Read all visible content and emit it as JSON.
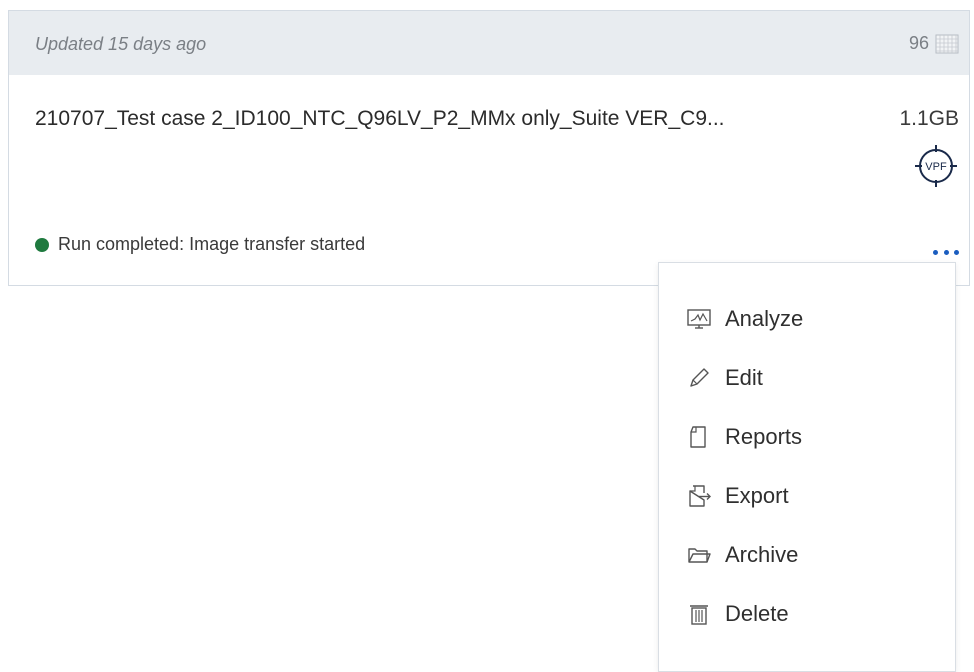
{
  "card": {
    "updated": "Updated 15 days ago",
    "well_count": "96",
    "run_name": "210707_Test case 2_ID100_NTC_Q96LV_P2_MMx only_Suite VER_C9...",
    "size": "1.1GB",
    "vpf_badge": "VPF",
    "status_text": "Run completed: Image transfer started",
    "status_color": "#1f7a3f"
  },
  "menu": {
    "analyze": "Analyze",
    "edit": "Edit",
    "reports": "Reports",
    "export": "Export",
    "archive": "Archive",
    "delete": "Delete"
  },
  "icons": {
    "plate": "plate-grid-icon",
    "vpf": "vpf-crosshair-icon",
    "more": "more-dots-icon",
    "analyze": "monitor-chart-icon",
    "edit": "pencil-icon",
    "reports": "document-icon",
    "export": "export-icon",
    "archive": "folder-icon",
    "delete": "trash-icon"
  },
  "colors": {
    "header_bg": "#e8ecf0",
    "accent": "#1b5dbf",
    "border": "#d4dbe3"
  }
}
